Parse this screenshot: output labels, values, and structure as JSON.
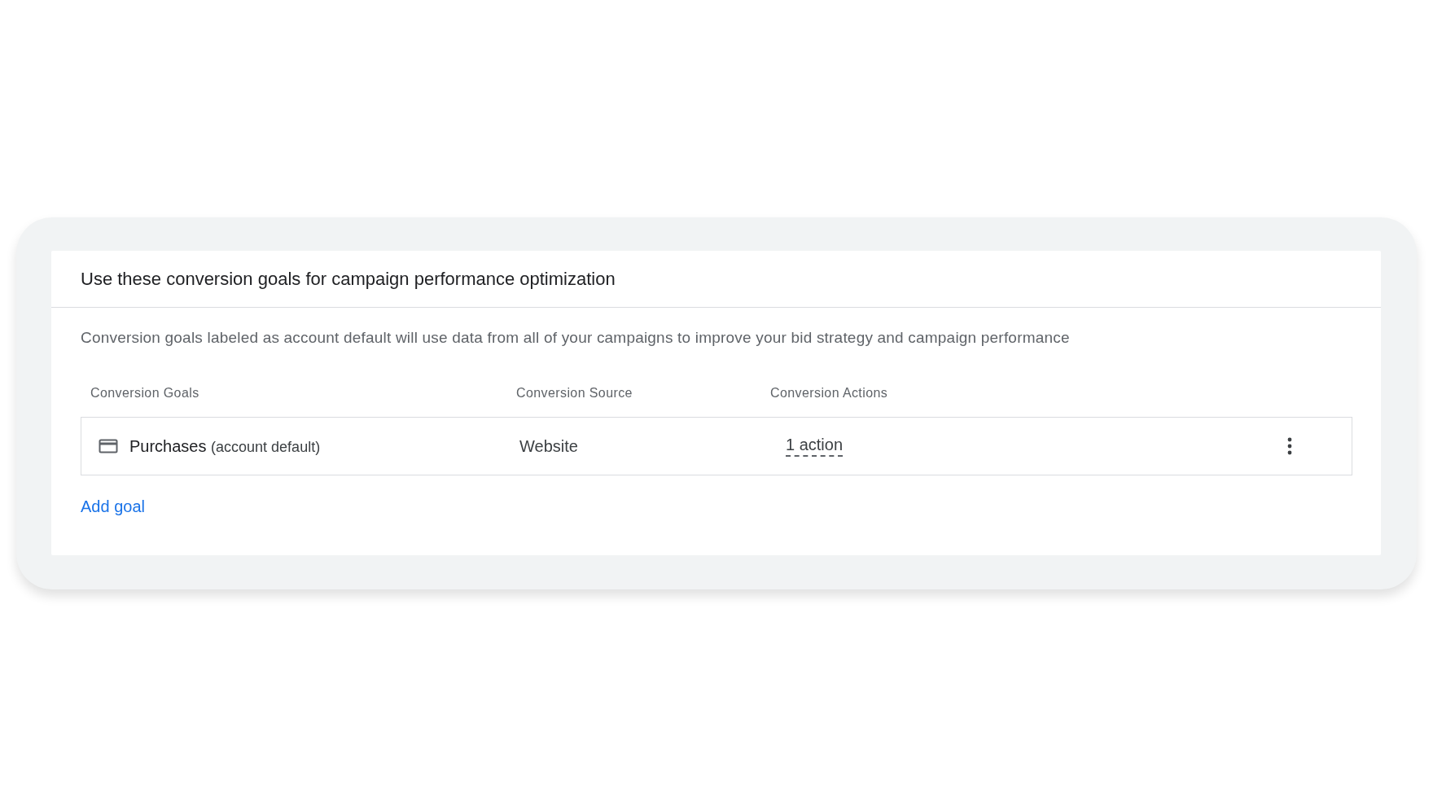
{
  "card": {
    "title": "Use these conversion goals for campaign performance optimization",
    "description": "Conversion goals labeled as account default will use data from all of your campaigns to improve your bid strategy and campaign performance",
    "table": {
      "columns": [
        "Conversion Goals",
        "Conversion Source",
        "Conversion Actions"
      ],
      "rows": [
        {
          "goal": "Purchases",
          "note": "(account default)",
          "source": "Website",
          "actions": "1 action"
        }
      ]
    },
    "add_link": "Add goal"
  }
}
